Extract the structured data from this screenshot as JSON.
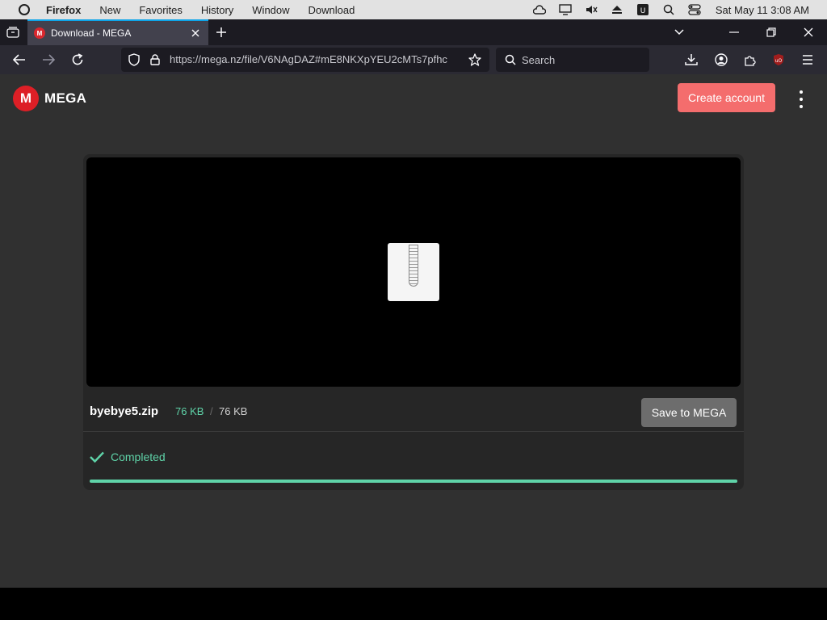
{
  "os": {
    "menu": [
      "Firefox",
      "New",
      "Favorites",
      "History",
      "Window",
      "Download"
    ],
    "clock": "Sat May 11  3:08 AM",
    "icons": [
      "cloud-icon",
      "display-icon",
      "mute-icon",
      "eject-icon",
      "ublock-tray-icon",
      "spotlight-search-icon",
      "control-center-icon"
    ]
  },
  "browser": {
    "tab_title": "Download - MEGA",
    "url": "https://mega.nz/file/V6NAgDAZ#mE8NKXpYEU2cMTs7pfhc",
    "search_placeholder": "Search"
  },
  "page": {
    "logo_text": "MEGA",
    "logo_letter": "M",
    "create_account": "Create account",
    "file": {
      "name": "byebye5.zip",
      "downloaded": "76 KB",
      "separator": "/",
      "total": "76 KB",
      "save_button": "Save to MEGA",
      "status": "Completed",
      "progress_fraction": 1.0
    }
  },
  "colors": {
    "brand_red": "#dd1f26",
    "create_button": "#f46d6d",
    "success_green": "#5fd3a8",
    "tab_accent": "#0ea5e9"
  }
}
